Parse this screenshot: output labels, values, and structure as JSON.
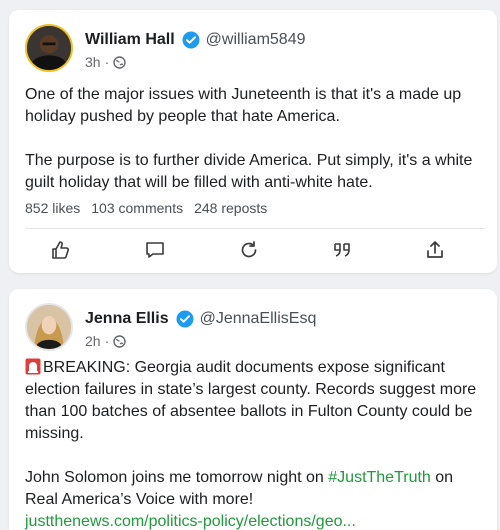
{
  "posts": [
    {
      "author": "William Hall",
      "handle": "@william5849",
      "time": "3h",
      "separator": "·",
      "paragraphs": [
        "One of the major issues with Juneteenth is that it's a made up holiday pushed by people that hate America.",
        "The purpose is to further divide America. Put simply, it's a white guilt holiday that will be filled with anti-white hate."
      ],
      "stats": {
        "likes": "852 likes",
        "comments": "103 comments",
        "reposts": "248 reposts"
      },
      "actions": [
        "like-icon",
        "comment-icon",
        "repost-icon",
        "quote-icon",
        "share-icon"
      ]
    },
    {
      "author": "Jenna Ellis",
      "handle": "@JennaEllisEsq",
      "time": "2h",
      "separator": "·",
      "p1": "BREAKING: Georgia audit documents expose significant election failures in state’s largest county. Records suggest more than 100 batches of absentee ballots in Fulton County could be missing.",
      "p2_before": "John Solomon joins me tomorrow night on ",
      "hashtag": "#JustTheTruth",
      "p2_after": " on Real America’s Voice with more!",
      "link": "justthenews.com/politics-policy/elections/geo..."
    }
  ],
  "colors": {
    "verified": "#1d9bf0",
    "accent_link": "#1f9b3a",
    "avatar_ring_1": "#f0c020"
  }
}
